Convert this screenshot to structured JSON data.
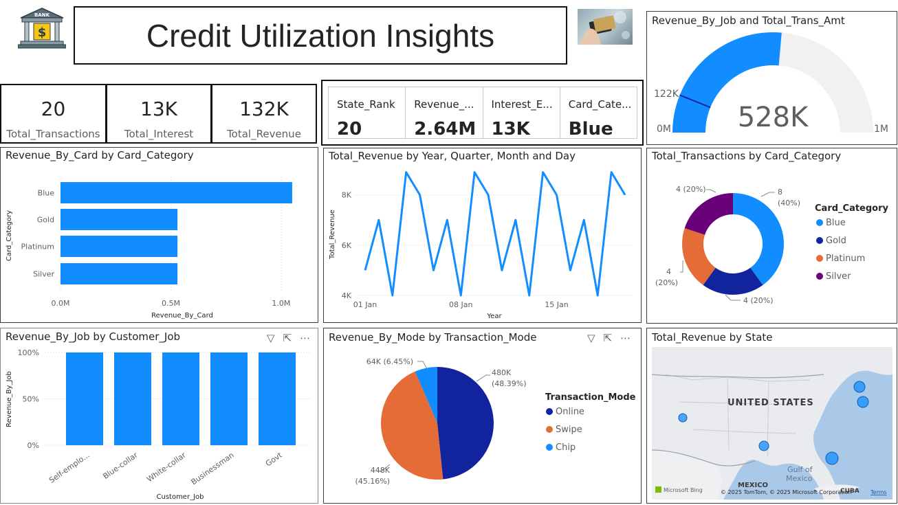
{
  "header": {
    "bank_label": "BANK",
    "title": "Credit Utilization Insights"
  },
  "kpis": [
    {
      "value": "20",
      "label": "Total_Transactions"
    },
    {
      "value": "13K",
      "label": "Total_Interest"
    },
    {
      "value": "132K",
      "label": "Total_Revenue"
    }
  ],
  "multi_card": [
    {
      "label": "State_Rank",
      "value": "20"
    },
    {
      "label": "Revenue_...",
      "value": "2.64M"
    },
    {
      "label": "Interest_E...",
      "value": "13K"
    },
    {
      "label": "Card_Cate...",
      "value": "Blue"
    }
  ],
  "colors": {
    "blue": "#118DFF",
    "dark_blue": "#12239E",
    "orange": "#E66C37",
    "purple": "#6B007B",
    "gauge_bg": "#F1F1F1"
  },
  "gauge": {
    "title": "Revenue_By_Job and Total_Trans_Amt",
    "value_label": "528K",
    "target_label": "122K",
    "min_label": "0M",
    "max_label": "1M",
    "value": 528000,
    "target": 122000,
    "min": 0,
    "max": 1000000
  },
  "card_bar": {
    "title": "Revenue_By_Card by Card_Category",
    "chart_data": {
      "type": "bar",
      "orientation": "horizontal",
      "categories": [
        "Blue",
        "Gold",
        "Platinum",
        "Silver"
      ],
      "values": [
        1.05,
        0.53,
        0.53,
        0.53
      ],
      "xlabel": "Revenue_By_Card",
      "ylabel": "Card_Category",
      "xlim": [
        0,
        1.1
      ],
      "ticks": [
        0,
        0.5,
        1.0
      ],
      "tick_labels": [
        "0.0M",
        "0.5M",
        "1.0M"
      ]
    }
  },
  "line": {
    "title": "Total_Revenue by Year, Quarter, Month and Day",
    "chart_data": {
      "type": "line",
      "x": [
        1,
        2,
        3,
        4,
        5,
        6,
        7,
        8,
        9,
        10,
        11,
        12,
        13,
        14,
        15,
        16,
        17,
        18,
        19,
        20
      ],
      "values": [
        5000,
        7000,
        4000,
        8900,
        8000,
        5000,
        7000,
        4000,
        8900,
        8000,
        5000,
        7000,
        4000,
        8900,
        8000,
        5000,
        7000,
        4000,
        8900,
        8000
      ],
      "xlabel": "Year",
      "ylabel": "Total_Revenue",
      "ylim": [
        4000,
        9000
      ],
      "yticks": [
        4000,
        6000,
        8000
      ],
      "ytick_labels": [
        "4K",
        "6K",
        "8K"
      ],
      "xticks": [
        1,
        8,
        15
      ],
      "xtick_labels": [
        "01 Jan",
        "08 Jan",
        "15 Jan"
      ]
    }
  },
  "donut": {
    "title": "Total_Transactions by Card_Category",
    "legend_title": "Card_Category",
    "chart_data": {
      "type": "pie",
      "categories": [
        "Blue",
        "Gold",
        "Platinum",
        "Silver"
      ],
      "values": [
        8,
        4,
        4,
        4
      ],
      "labels": [
        "8",
        "4 (20%)",
        "4",
        "4 (20%)"
      ],
      "percents": [
        "(40%)",
        "",
        "(20%)",
        ""
      ]
    }
  },
  "job_bar": {
    "title": "Revenue_By_Job by Customer_Job",
    "chart_data": {
      "type": "bar",
      "categories": [
        "Self-emplo...",
        "Blue-collar",
        "White-collar",
        "Businessman",
        "Govt"
      ],
      "values": [
        100,
        100,
        100,
        100,
        100
      ],
      "xlabel": "Customer_Job",
      "ylabel": "Revenue_By_Job",
      "ylim": [
        0,
        100
      ],
      "yticks": [
        0,
        50,
        100
      ],
      "ytick_labels": [
        "0%",
        "50%",
        "100%"
      ]
    }
  },
  "mode_pie": {
    "title": "Revenue_By_Mode by Transaction_Mode",
    "legend_title": "Transaction_Mode",
    "chart_data": {
      "type": "pie",
      "categories": [
        "Online",
        "Swipe",
        "Chip"
      ],
      "values": [
        480,
        448,
        64
      ],
      "value_labels": [
        "480K",
        "448K",
        "64K (6.45%)"
      ],
      "percent_labels": [
        "(48.39%)",
        "(45.16%)",
        ""
      ]
    }
  },
  "map": {
    "title": "Total_Revenue by State",
    "country_label": "UNITED STATES",
    "gulf_label": "Gulf of",
    "gulf_label2": "Mexico",
    "mexico_label": "MEXICO",
    "cuba_label": "CUBA",
    "bing_label": "Microsoft Bing",
    "copyright": "© 2025 TomTom, © 2025 Microsoft Corporation",
    "terms": "Terms"
  }
}
